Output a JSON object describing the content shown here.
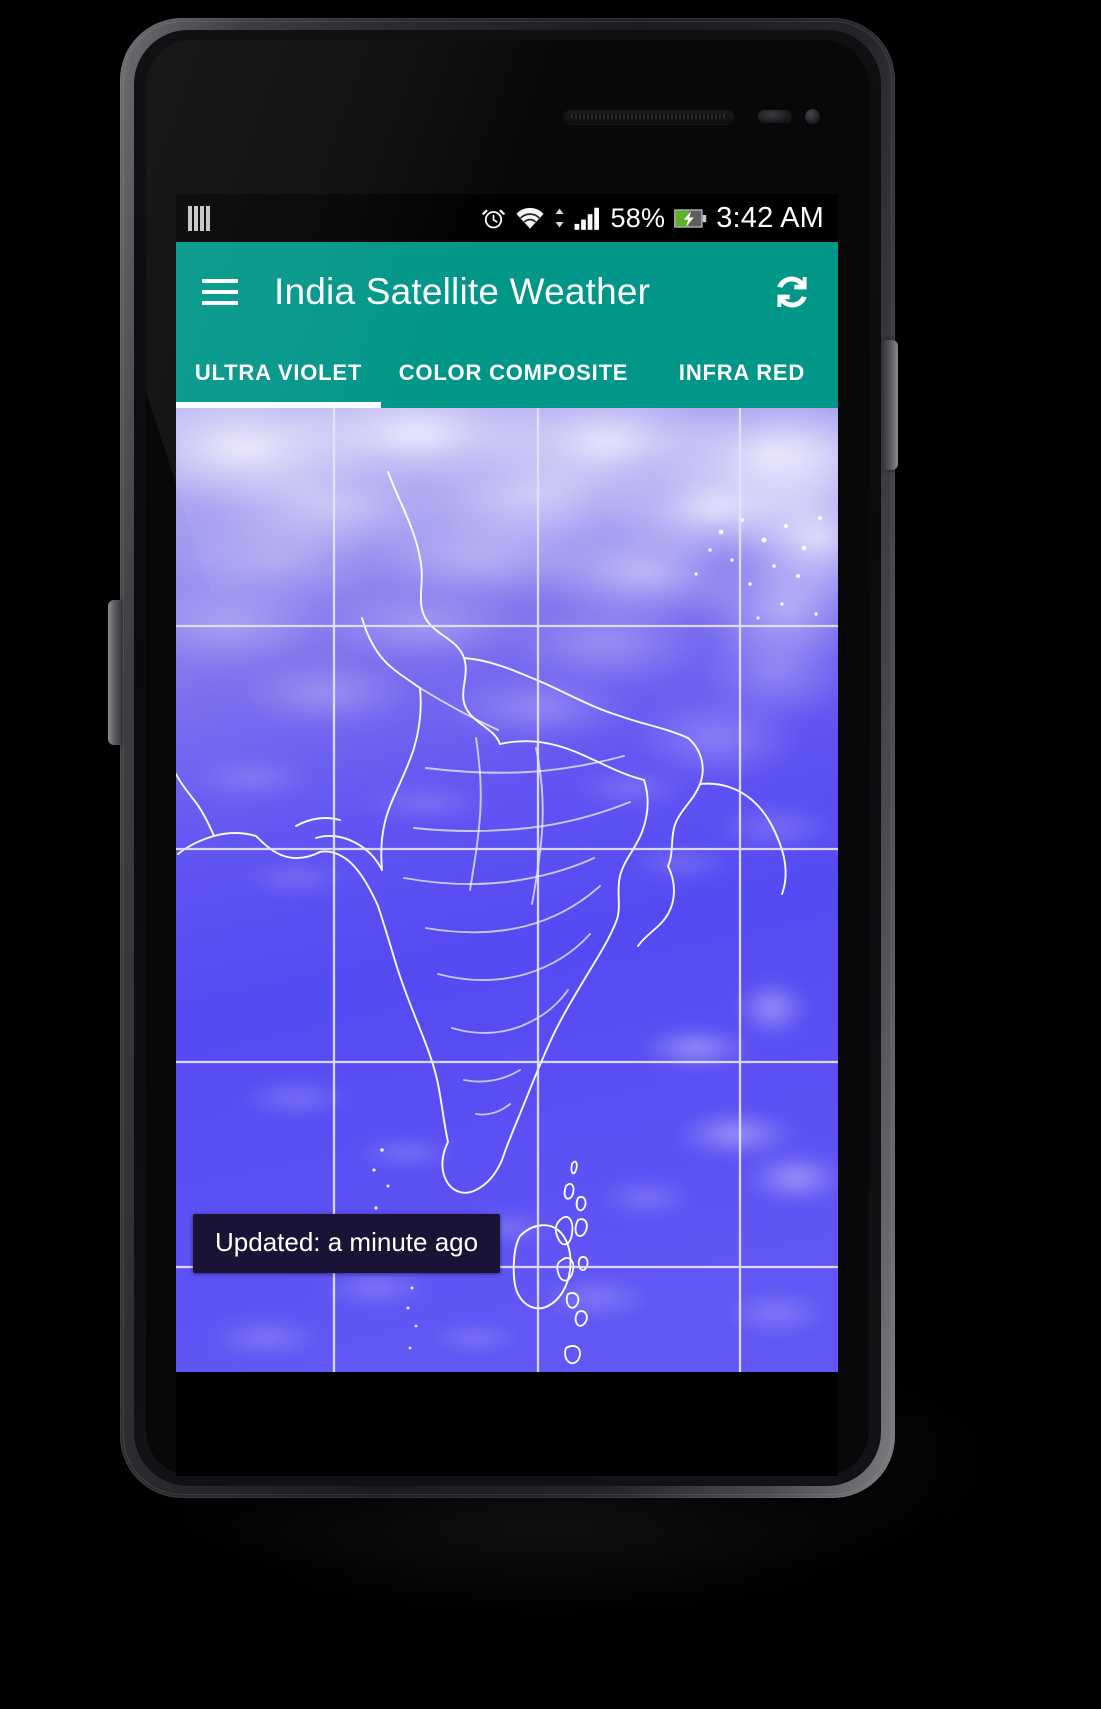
{
  "device": {
    "type": "android-phone-mockup",
    "frame_color": "#3d3e42"
  },
  "statusbar": {
    "sim_icon": "sim-card-icon",
    "alarm_icon": "alarm-icon",
    "wifi_icon": "wifi-icon",
    "data_transfer_icon": "up-down-arrows-icon",
    "signal_icon": "cellular-signal-icon",
    "battery_percent": "58%",
    "battery_icon": "battery-charging-icon",
    "time": "3:42 AM"
  },
  "appbar": {
    "menu_icon": "hamburger-menu-icon",
    "title": "India Satellite Weather",
    "refresh_icon": "refresh-icon",
    "background_color": "#009688"
  },
  "tabs": {
    "items": [
      {
        "label": "ULTRA VIOLET",
        "active": true
      },
      {
        "label": "COLOR COMPOSITE",
        "active": false
      },
      {
        "label": "INFRA RED",
        "active": false
      }
    ],
    "indicator_color": "#ffffff"
  },
  "map": {
    "description": "ultra-violet satellite image of the Indian subcontinent with latitude and longitude grid lines",
    "base_color": "#5a4ef0",
    "grid_color": "#d7d3ef",
    "coast_color": "#ffffff"
  },
  "toast": {
    "message": "Updated: a minute ago",
    "background_color": "#1a1336",
    "text_color": "#ffffff"
  }
}
